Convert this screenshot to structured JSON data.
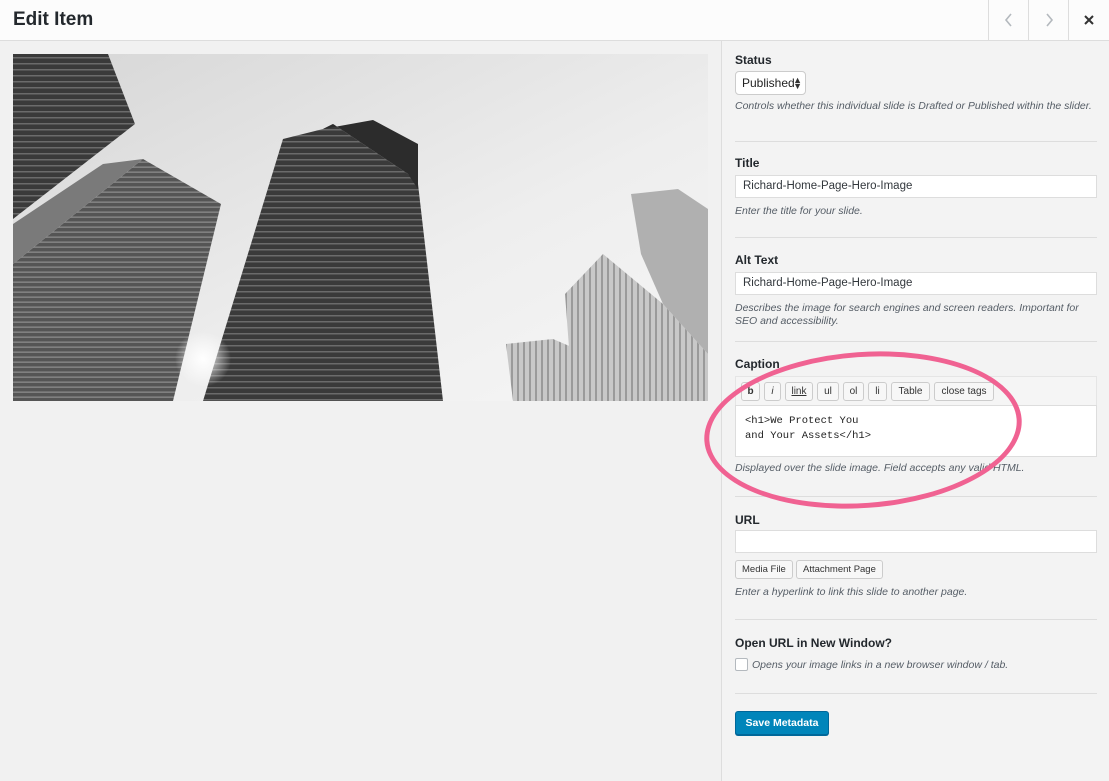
{
  "header": {
    "title": "Edit Item",
    "prev_icon": "chevron-left",
    "next_icon": "chevron-right",
    "close_icon": "close-x"
  },
  "image": {
    "subject": "grayscale low-angle photo of skyscrapers"
  },
  "status": {
    "label": "Status",
    "value": "Published",
    "description": "Controls whether this individual slide is Drafted or Published within the slider."
  },
  "title_field": {
    "label": "Title",
    "value": "Richard-Home-Page-Hero-Image",
    "description": "Enter the title for your slide."
  },
  "alt_text": {
    "label": "Alt Text",
    "value": "Richard-Home-Page-Hero-Image",
    "description": "Describes the image for search engines and screen readers. Important for SEO and accessibility."
  },
  "caption": {
    "label": "Caption",
    "toolbar": [
      "b",
      "i",
      "link",
      "ul",
      "ol",
      "li",
      "Table",
      "close tags"
    ],
    "value": "<h1>We Protect You\nand Your Assets</h1>",
    "description": "Displayed over the slide image. Field accepts any valid HTML."
  },
  "url": {
    "label": "URL",
    "value": "",
    "media_file_label": "Media File",
    "attachment_page_label": "Attachment Page",
    "description": "Enter a hyperlink to link this slide to another page."
  },
  "new_window": {
    "label": "Open URL in New Window?",
    "checked": false,
    "description": "Opens your image links in a new browser window / tab."
  },
  "save_label": "Save Metadata",
  "colors": {
    "primary": "#0085ba",
    "highlight": "#f06292"
  }
}
